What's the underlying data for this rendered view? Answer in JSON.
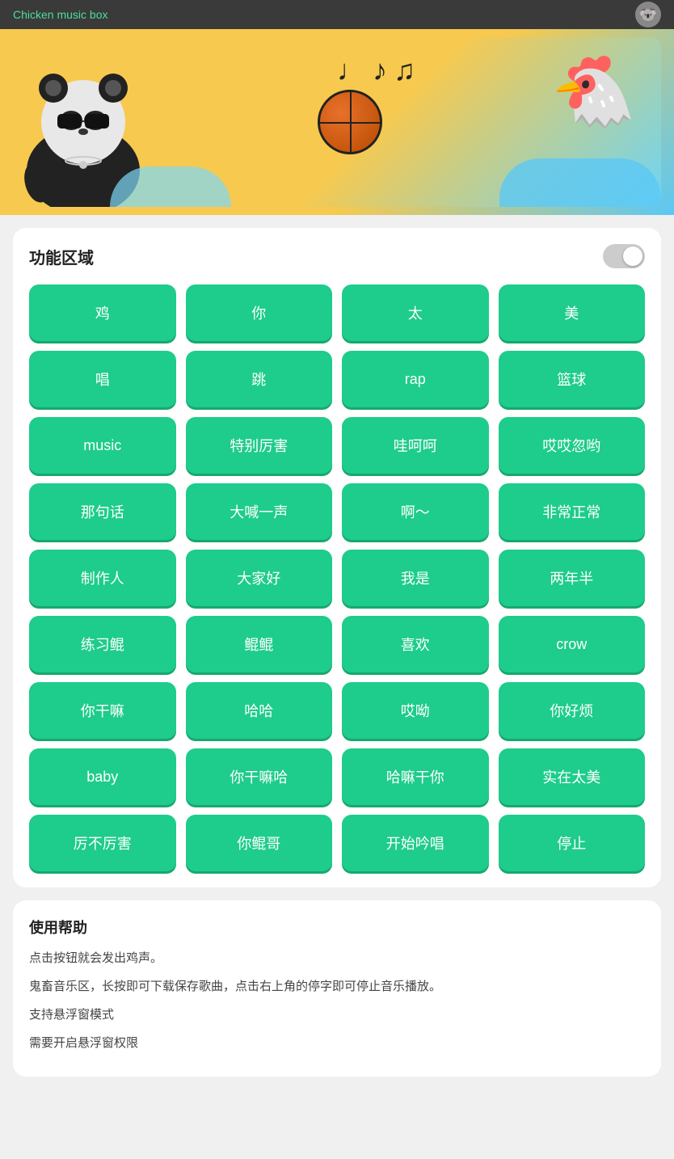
{
  "header": {
    "title": "Chicken music box",
    "avatar_icon": "🐼"
  },
  "banner": {
    "notes": "♩ ♪ ♫",
    "panda_emoji": "🐼",
    "chicken_emoji": "🐔"
  },
  "function_area": {
    "title": "功能区域",
    "toggle_label": "toggle",
    "buttons": [
      "鸡",
      "你",
      "太",
      "美",
      "唱",
      "跳",
      "rap",
      "篮球",
      "music",
      "特别厉害",
      "哇呵呵",
      "哎哎忽哟",
      "那句话",
      "大喊一声",
      "啊～",
      "非常正常",
      "制作人",
      "大家好",
      "我是",
      "两年半",
      "练习鲲",
      "鲲鲲",
      "喜欢",
      "crow",
      "你干嘛",
      "哈哈",
      "哎呦",
      "你好烦",
      "baby",
      "你干嘛哈",
      "哈嘛干你",
      "实在太美",
      "厉不厉害",
      "你鲲哥",
      "开始吟唱",
      "停止"
    ]
  },
  "help": {
    "title": "使用帮助",
    "lines": [
      "点击按钮就会发出鸡声。",
      "鬼畜音乐区，长按即可下载保存歌曲，点击右上角的停字即可停止音乐播放。",
      "支持悬浮窗模式",
      "需要开启悬浮窗权限"
    ]
  }
}
